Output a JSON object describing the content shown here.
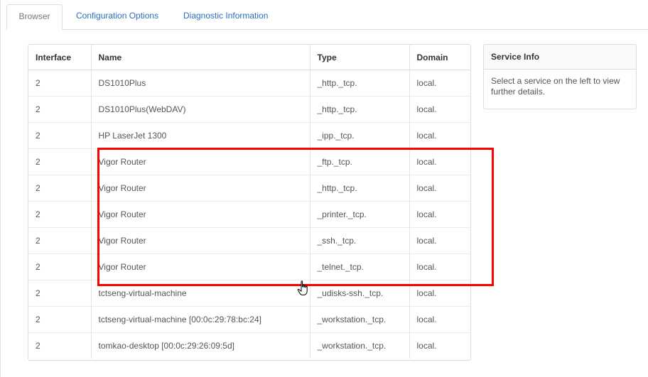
{
  "tabs": [
    {
      "label": "Browser",
      "active": true
    },
    {
      "label": "Configuration Options",
      "active": false
    },
    {
      "label": "Diagnostic Information",
      "active": false
    }
  ],
  "table": {
    "headers": [
      "Interface",
      "Name",
      "Type",
      "Domain"
    ],
    "rows": [
      [
        "2",
        "DS1010Plus",
        "_http._tcp.",
        "local."
      ],
      [
        "2",
        "DS1010Plus(WebDAV)",
        "_http._tcp.",
        "local."
      ],
      [
        "2",
        "HP LaserJet 1300",
        "_ipp._tcp.",
        "local."
      ],
      [
        "2",
        "Vigor Router",
        "_ftp._tcp.",
        "local."
      ],
      [
        "2",
        "Vigor Router",
        "_http._tcp.",
        "local."
      ],
      [
        "2",
        "Vigor Router",
        "_printer._tcp.",
        "local."
      ],
      [
        "2",
        "Vigor Router",
        "_ssh._tcp.",
        "local."
      ],
      [
        "2",
        "Vigor Router",
        "_telnet._tcp.",
        "local."
      ],
      [
        "2",
        "tctseng-virtual-machine",
        "_udisks-ssh._tcp.",
        "local."
      ],
      [
        "2",
        "tctseng-virtual-machine [00:0c:29:78:bc:24]",
        "_workstation._tcp.",
        "local."
      ],
      [
        "2",
        "tomkao-desktop [00:0c:29:26:09:5d]",
        "_workstation._tcp.",
        "local."
      ]
    ]
  },
  "service_info": {
    "title": "Service Info",
    "text": "Select a service on the left to view further details."
  },
  "colors": {
    "link": "#2a6ebc",
    "highlight": "#ff0000"
  },
  "cursor_icon": "hand-pointer-icon"
}
